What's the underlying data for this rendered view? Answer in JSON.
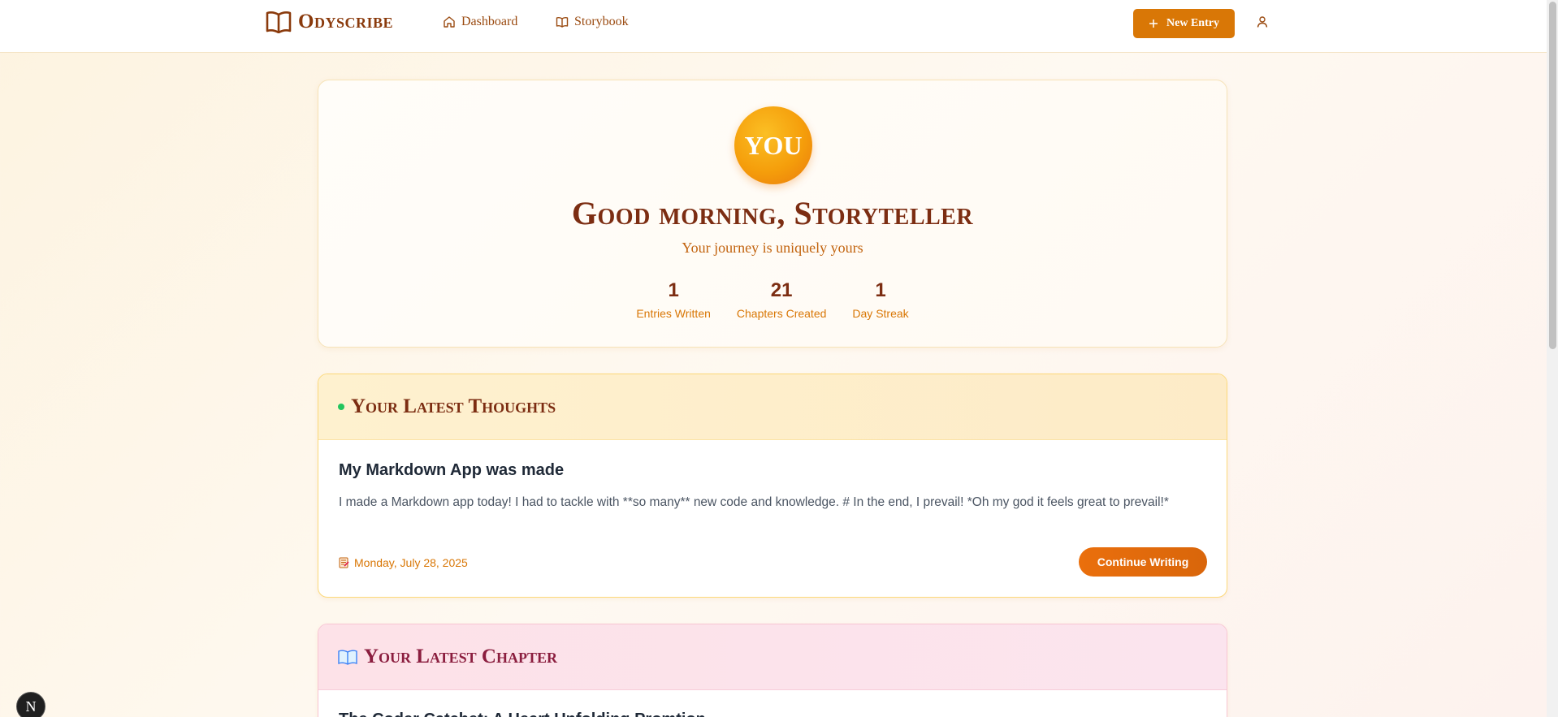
{
  "header": {
    "brand": "Odyscribe",
    "nav": {
      "dashboard": "Dashboard",
      "storybook": "Storybook"
    },
    "new_entry_label": "New Entry"
  },
  "hero": {
    "avatar_text": "YOU",
    "greeting": "Good morning, Storyteller",
    "subtitle": "Your journey is uniquely yours",
    "stats": [
      {
        "value": "1",
        "label": "Entries Written"
      },
      {
        "value": "21",
        "label": "Chapters Created"
      },
      {
        "value": "1",
        "label": "Day Streak"
      }
    ]
  },
  "thoughts": {
    "heading": "Your Latest Thoughts",
    "entry_title": "My Markdown App was made",
    "entry_body": "I made a Markdown app today! I had to tackle with **so many** new code and knowledge. # In the end, I prevail! *Oh my god it feels great to prevail!*",
    "date": "Monday, July 28, 2025",
    "continue_label": "Continue Writing"
  },
  "chapter": {
    "heading": "Your Latest Chapter",
    "title": "The Coder Catchet: A Heart Unfolding Promtion"
  },
  "badge": {
    "letter": "N"
  },
  "colors": {
    "accent": "#d97706",
    "brand": "#8a3a0c",
    "status_dot": "#22c55e"
  },
  "icons": {
    "brand": "open-book-icon",
    "dashboard": "home-icon",
    "storybook": "book-icon",
    "new_entry": "plus-icon",
    "user": "user-icon",
    "date": "memo-icon",
    "chapter": "book-emoji-icon"
  }
}
